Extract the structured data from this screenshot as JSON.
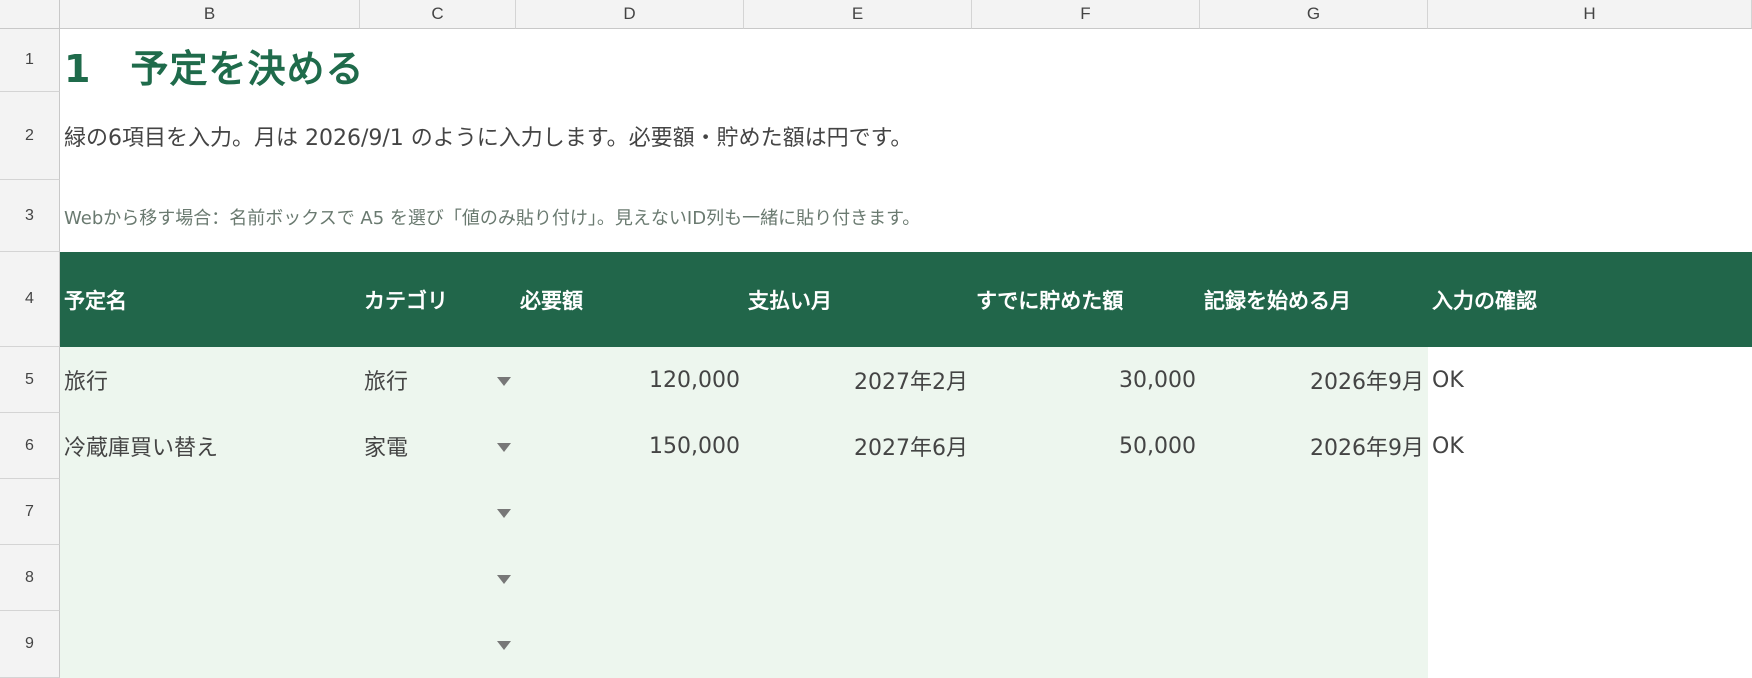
{
  "columns": [
    "B",
    "C",
    "D",
    "E",
    "F",
    "G",
    "H"
  ],
  "rows": [
    "1",
    "2",
    "3",
    "4",
    "5",
    "6",
    "7",
    "8",
    "9"
  ],
  "title": "1　予定を決める",
  "description": "緑の6項目を入力。月は 2026/9/1 のように入力します。必要額・貯めた額は円です。",
  "note": "Webから移す場合：名前ボックスで A5 を選び「値のみ貼り付け」。見えないID列も一緒に貼り付きます。",
  "headers": [
    "予定名",
    "カテゴリ",
    "必要額",
    "支払い月",
    "すでに貯めた額",
    "記録を始める月",
    "入力の確認"
  ],
  "data_rows": [
    {
      "name": "旅行",
      "category": "旅行",
      "amount": "120,000",
      "pay_month": "2027年2月",
      "saved": "30,000",
      "start_month": "2026年9月",
      "check": "OK"
    },
    {
      "name": "冷蔵庫買い替え",
      "category": "家電",
      "amount": "150,000",
      "pay_month": "2027年6月",
      "saved": "50,000",
      "start_month": "2026年9月",
      "check": "OK"
    },
    {
      "name": "",
      "category": "",
      "amount": "",
      "pay_month": "",
      "saved": "",
      "start_month": "",
      "check": ""
    },
    {
      "name": "",
      "category": "",
      "amount": "",
      "pay_month": "",
      "saved": "",
      "start_month": "",
      "check": ""
    },
    {
      "name": "",
      "category": "",
      "amount": "",
      "pay_month": "",
      "saved": "",
      "start_month": "",
      "check": ""
    }
  ],
  "dropdown_icon": "chevron-down-icon",
  "colors": {
    "header_bg": "#21664a",
    "input_bg": "#edf6ee",
    "title": "#1f6b4b"
  }
}
